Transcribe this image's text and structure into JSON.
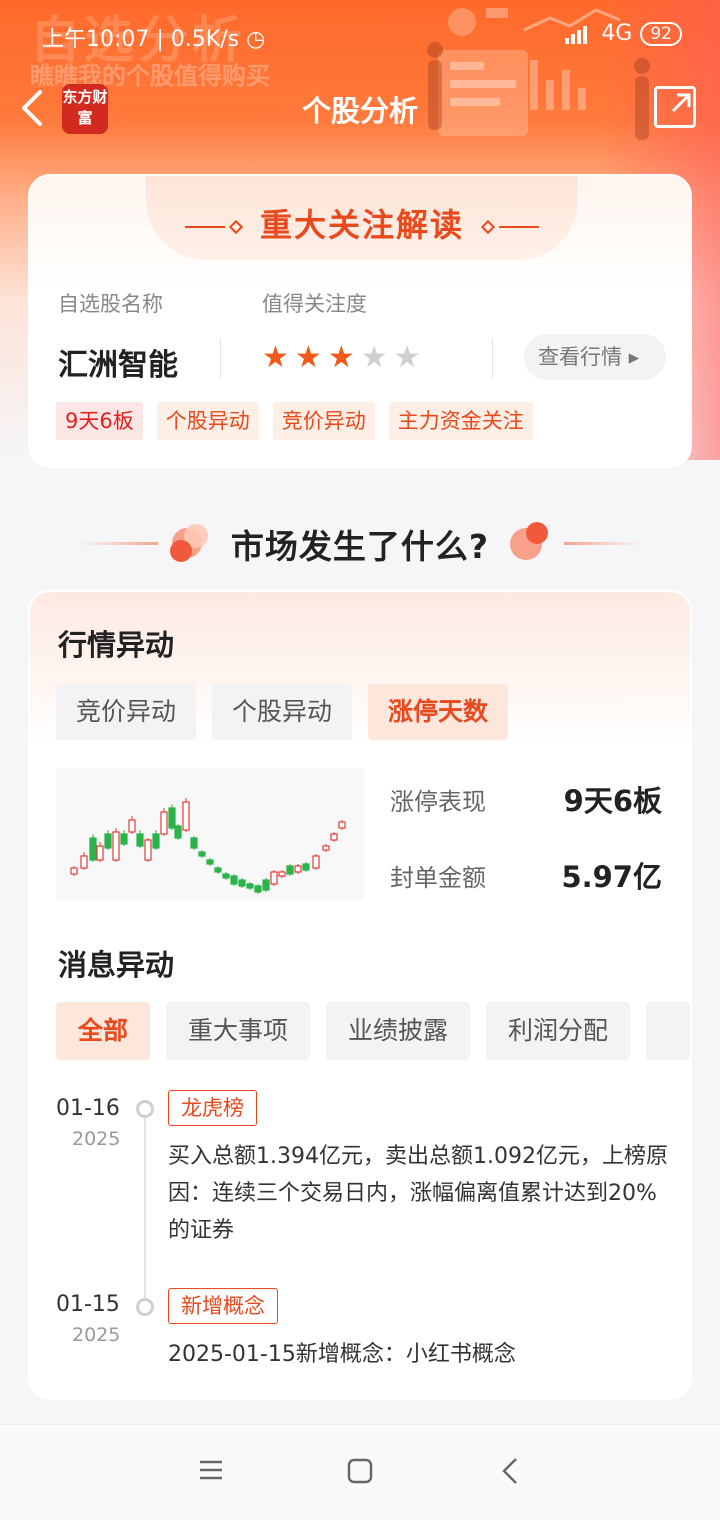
{
  "status_bar": {
    "time": "上午10:07 | 0.5K/s ◷",
    "network": "4G",
    "battery": "92"
  },
  "header": {
    "watermark": "自选分析",
    "watermark_sub": "瞧瞧我的个股值得购买",
    "logo": "东方财富",
    "title": "个股分析"
  },
  "focus_card": {
    "title": "重大关注解读",
    "name_label": "自选股名称",
    "attention_label": "值得关注度",
    "stock_name": "汇洲智能",
    "rating": 3,
    "rating_max": 5,
    "view_button": "查看行情 ▸",
    "tags": [
      "9天6板",
      "个股异动",
      "竞价异动",
      "主力资金关注"
    ]
  },
  "section": {
    "title": "市场发生了什么?"
  },
  "market": {
    "title": "行情异动",
    "tabs": [
      "竞价异动",
      "个股异动",
      "涨停天数"
    ],
    "active_tab": "涨停天数",
    "limit_label": "涨停表现",
    "limit_value": "9天6板",
    "seal_label": "封单金额",
    "seal_value": "5.97亿"
  },
  "news": {
    "title": "消息异动",
    "tabs": [
      "全部",
      "重大事项",
      "业绩披露",
      "利润分配"
    ],
    "active_tab": "全部",
    "items": [
      {
        "date": "01-16",
        "year": "2025",
        "tag": "龙虎榜",
        "text": "买入总额1.394亿元，卖出总额1.092亿元，上榜原因：连续三个交易日内，涨幅偏离值累计达到20%的证券"
      },
      {
        "date": "01-15",
        "year": "2025",
        "tag": "新增概念",
        "text": "2025-01-15新增概念：小红书概念"
      }
    ]
  },
  "colors": {
    "accent": "#e8491d",
    "rise": "#e53935",
    "fall": "#2bb34a"
  }
}
